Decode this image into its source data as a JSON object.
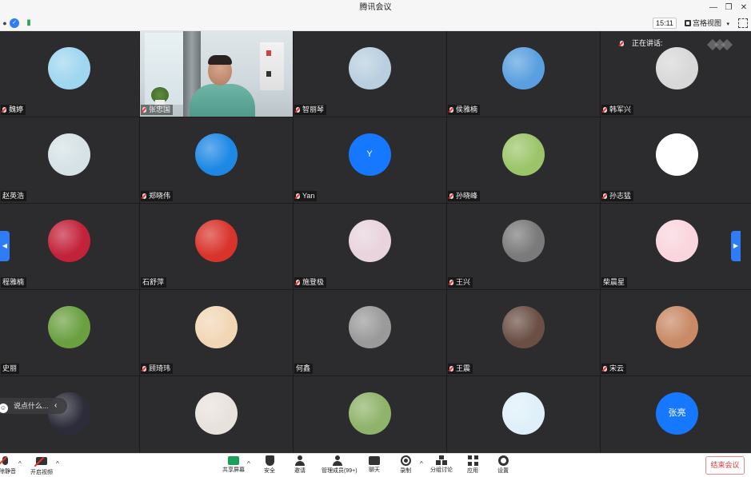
{
  "window": {
    "title": "腾讯会议",
    "minimize": "—",
    "restore": "❐",
    "close": "✕"
  },
  "infobar": {
    "time": "15:11",
    "view_label": "宫格视图"
  },
  "speaking": {
    "label": "正在讲话:"
  },
  "chat": {
    "placeholder": "说点什么..."
  },
  "participants": [
    {
      "name": "魏婷",
      "muted": true,
      "avatar": "cartoon-girl",
      "color": "#9fd6f0"
    },
    {
      "name": "张忠国",
      "muted": true,
      "avatar": "video",
      "color": "#cfd8dc"
    },
    {
      "name": "智丽琴",
      "muted": true,
      "avatar": "stuffed-toy",
      "color": "#b9cfe0"
    },
    {
      "name": "侯雅楠",
      "muted": true,
      "avatar": "minion-cartoon",
      "color": "#5aa0e0"
    },
    {
      "name": "韩军兴",
      "muted": true,
      "avatar": "kitten",
      "color": "#d8d8d8"
    },
    {
      "name": "赵英浩",
      "muted": false,
      "avatar": "baby-photo",
      "color": "#d6e2e6"
    },
    {
      "name": "郑晓伟",
      "muted": true,
      "avatar": "qq-zone-star",
      "color": "#1e88e5"
    },
    {
      "name": "Yan",
      "muted": true,
      "avatar": "letter",
      "color": "#1677ff",
      "initial": "Y"
    },
    {
      "name": "孙晓峰",
      "muted": true,
      "avatar": "two-kids",
      "color": "#9cc56a"
    },
    {
      "name": "孙志猛",
      "muted": true,
      "avatar": "bowl-logo",
      "color": "#ffffff"
    },
    {
      "name": "程雅楠",
      "muted": false,
      "avatar": "red-cartoon",
      "color": "#c2223a"
    },
    {
      "name": "石舒萍",
      "muted": false,
      "avatar": "rabbit-cartoon",
      "color": "#d9342c"
    },
    {
      "name": "施登极",
      "muted": true,
      "avatar": "anime-girl",
      "color": "#e9d3dd"
    },
    {
      "name": "王兴",
      "muted": true,
      "avatar": "cage-animal",
      "color": "#7a7a7a"
    },
    {
      "name": "柴晨星",
      "muted": false,
      "avatar": "pink-cartoon",
      "color": "#fad5de"
    },
    {
      "name": "史丽",
      "muted": false,
      "avatar": "green-flower",
      "color": "#6aa040"
    },
    {
      "name": "顾琦玮",
      "muted": true,
      "avatar": "girl-drawing",
      "color": "#f2d7b6"
    },
    {
      "name": "何鑫",
      "muted": false,
      "avatar": "bw-photo",
      "color": "#9a9a9a"
    },
    {
      "name": "王震",
      "muted": true,
      "avatar": "car-photo",
      "color": "#6b4f45"
    },
    {
      "name": "宋云",
      "muted": true,
      "avatar": "building-photo",
      "color": "#c98a66"
    },
    {
      "name": "",
      "muted": false,
      "avatar": "dark-figure",
      "color": "#2c2c3a"
    },
    {
      "name": "",
      "muted": false,
      "avatar": "girl-photo",
      "color": "#e8e2dd"
    },
    {
      "name": "",
      "muted": false,
      "avatar": "kids-trees",
      "color": "#8fb36a"
    },
    {
      "name": "",
      "muted": false,
      "avatar": "boy-cartoon",
      "color": "#dff0fa"
    },
    {
      "name": "",
      "muted": false,
      "avatar": "letter",
      "color": "#1677ff",
      "initial": "张亮"
    }
  ],
  "toolbar": {
    "mute_label": "解除静音",
    "video_label": "开启视频",
    "share_label": "共享屏幕",
    "security_label": "安全",
    "invite_label": "邀请",
    "members_label": "管理成员(99+)",
    "chat_label": "聊天",
    "record_label": "录制",
    "breakout_label": "分组讨论",
    "apps_label": "应用",
    "settings_label": "设置",
    "end_label": "结束会议"
  }
}
